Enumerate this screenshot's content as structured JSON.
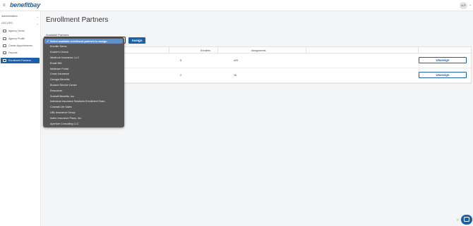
{
  "app": {
    "logo_text": "benefitbay",
    "user_initials": "A.P"
  },
  "sidebar": {
    "sections": [
      {
        "label": "Administration"
      },
      {
        "label": "LRC-EPG"
      }
    ],
    "items": [
      {
        "label": "Agency Home",
        "icon": "home-icon"
      },
      {
        "label": "Agency Profile",
        "icon": "id-card-icon"
      },
      {
        "label": "Carrier Appointments",
        "icon": "handshake-icon"
      },
      {
        "label": "Reports",
        "icon": "report-icon"
      },
      {
        "label": "Enrollment Partners",
        "icon": "partners-icon",
        "active": true
      }
    ]
  },
  "page": {
    "title": "Enrollment Partners",
    "available_partners_label": "Available Partners",
    "assign_label": "Assign"
  },
  "table": {
    "headers": [
      "Enrollers",
      "Assignments"
    ],
    "rows": [
      {
        "enrollers": "5",
        "assignments": "429",
        "action": "Unassign"
      },
      {
        "enrollers": "2",
        "assignments": "16",
        "action": "Unassign"
      }
    ]
  },
  "dropdown": {
    "options": [
      "Select available enrollment partners to assign",
      "Enroller Demo",
      "Doctor's Choice",
      "WestLink Insurance, LLC",
      "Email 365",
      "Medicare Portal",
      "Cross Insurance",
      "Georgia Benefits",
      "Browne Service Center",
      "Resourcer",
      "Sunbelt Benefits, Inc.",
      "Individual Insurance Solutions Enrollment Team",
      "Colonial Life Sales",
      "UBL Insurance Group",
      "Idaho Insurance Plans, Inc.",
      "Aperture Consulting LLC"
    ],
    "selected_index": 0
  },
  "colors": {
    "brand": "#1c5fa8",
    "dropdown_bg": "#565656",
    "selected_bg": "#5a8fd6"
  }
}
